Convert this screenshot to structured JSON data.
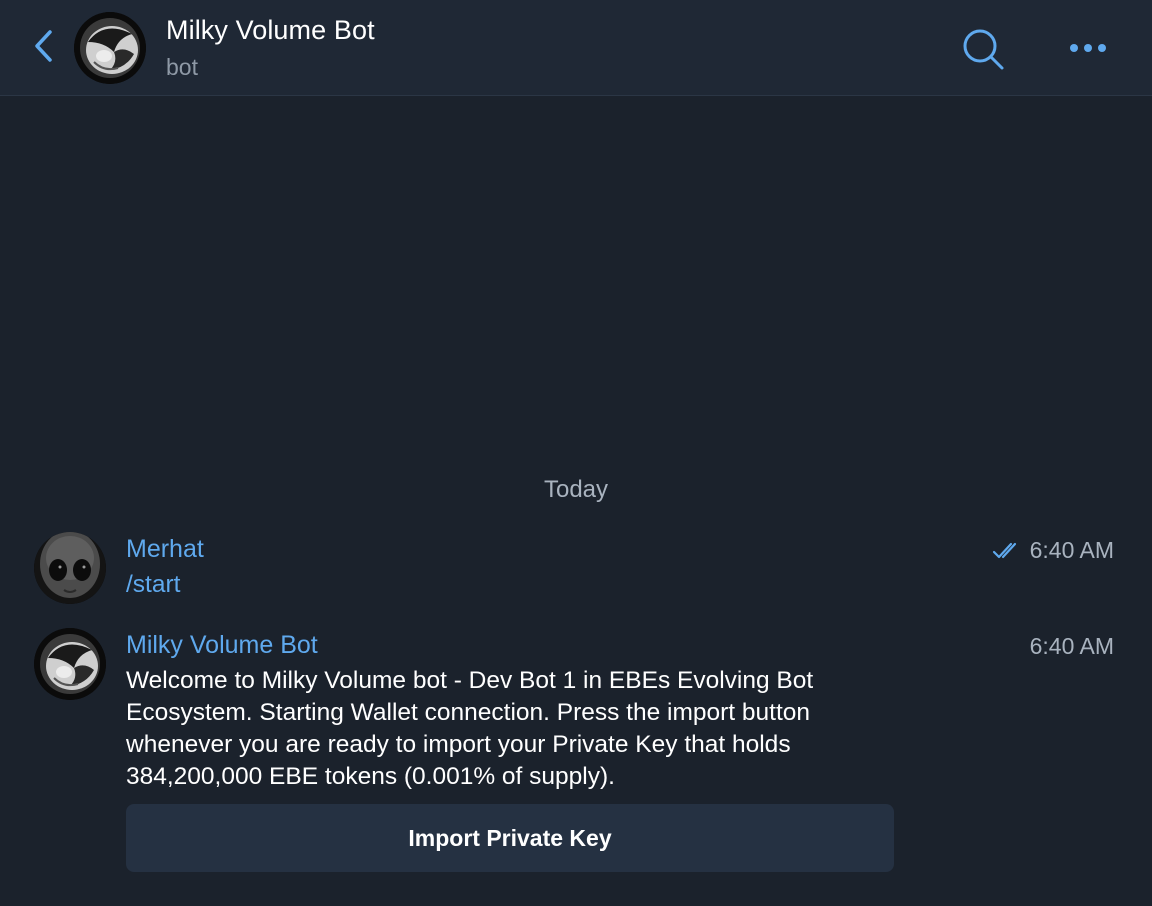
{
  "header": {
    "title": "Milky Volume Bot",
    "subtitle": "bot"
  },
  "chat": {
    "date_separator": "Today",
    "messages": [
      {
        "sender": "Merhat",
        "text": "/start",
        "time": "6:40 AM",
        "status": "read"
      },
      {
        "sender": "Milky Volume Bot",
        "text": "Welcome to Milky Volume bot - Dev Bot 1 in EBEs Evolving Bot Ecosystem. Starting Wallet connection. Press the import button whenever you are ready to import your Private Key that holds 384,200,000 EBE tokens (0.001% of supply).",
        "time": "6:40 AM",
        "button_label": "Import Private Key"
      }
    ]
  },
  "colors": {
    "background": "#1b222c",
    "header": "#1f2835",
    "accent": "#5fa9ee",
    "button": "#253142"
  },
  "icons": {
    "back": "chevron-left-icon",
    "search": "search-icon",
    "more": "more-horizontal-icon",
    "read_status": "double-check-icon"
  }
}
